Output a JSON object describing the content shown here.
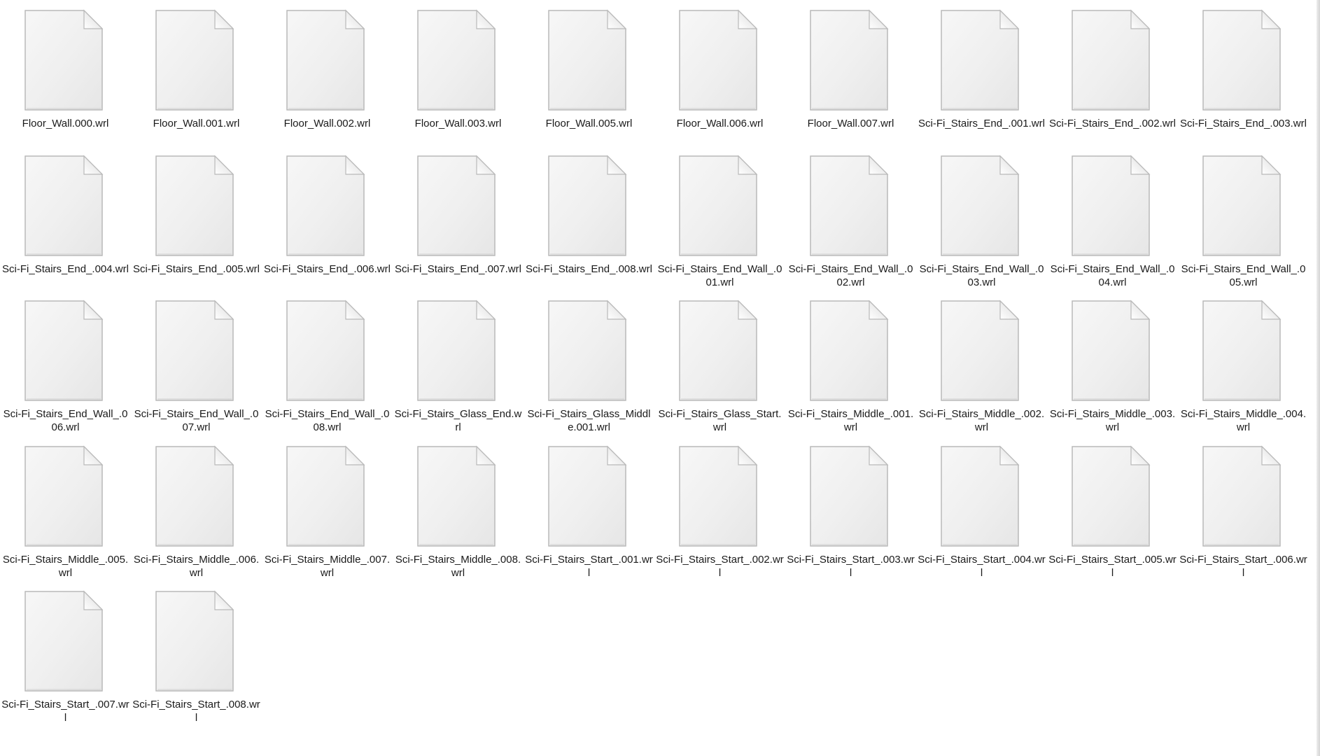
{
  "files": [
    {
      "name": "Floor_Wall.000.wrl",
      "icon": "document-icon"
    },
    {
      "name": "Floor_Wall.001.wrl",
      "icon": "document-icon"
    },
    {
      "name": "Floor_Wall.002.wrl",
      "icon": "document-icon"
    },
    {
      "name": "Floor_Wall.003.wrl",
      "icon": "document-icon"
    },
    {
      "name": "Floor_Wall.005.wrl",
      "icon": "document-icon"
    },
    {
      "name": "Floor_Wall.006.wrl",
      "icon": "document-icon"
    },
    {
      "name": "Floor_Wall.007.wrl",
      "icon": "document-icon"
    },
    {
      "name": "Sci-Fi_Stairs_End_.001.wrl",
      "icon": "document-icon"
    },
    {
      "name": "Sci-Fi_Stairs_End_.002.wrl",
      "icon": "document-icon"
    },
    {
      "name": "Sci-Fi_Stairs_End_.003.wrl",
      "icon": "document-icon"
    },
    {
      "name": "Sci-Fi_Stairs_End_.004.wrl",
      "icon": "document-icon"
    },
    {
      "name": "Sci-Fi_Stairs_End_.005.wrl",
      "icon": "document-icon"
    },
    {
      "name": "Sci-Fi_Stairs_End_.006.wrl",
      "icon": "document-icon"
    },
    {
      "name": "Sci-Fi_Stairs_End_.007.wrl",
      "icon": "document-icon"
    },
    {
      "name": "Sci-Fi_Stairs_End_.008.wrl",
      "icon": "document-icon"
    },
    {
      "name": "Sci-Fi_Stairs_End_Wall_.001.wrl",
      "icon": "document-icon"
    },
    {
      "name": "Sci-Fi_Stairs_End_Wall_.002.wrl",
      "icon": "document-icon"
    },
    {
      "name": "Sci-Fi_Stairs_End_Wall_.003.wrl",
      "icon": "document-icon"
    },
    {
      "name": "Sci-Fi_Stairs_End_Wall_.004.wrl",
      "icon": "document-icon"
    },
    {
      "name": "Sci-Fi_Stairs_End_Wall_.005.wrl",
      "icon": "document-icon"
    },
    {
      "name": "Sci-Fi_Stairs_End_Wall_.006.wrl",
      "icon": "document-icon"
    },
    {
      "name": "Sci-Fi_Stairs_End_Wall_.007.wrl",
      "icon": "document-icon"
    },
    {
      "name": "Sci-Fi_Stairs_End_Wall_.008.wrl",
      "icon": "document-icon"
    },
    {
      "name": "Sci-Fi_Stairs_Glass_End.wrl",
      "icon": "document-icon"
    },
    {
      "name": "Sci-Fi_Stairs_Glass_Middle.001.wrl",
      "icon": "document-icon"
    },
    {
      "name": "Sci-Fi_Stairs_Glass_Start.wrl",
      "icon": "document-icon"
    },
    {
      "name": "Sci-Fi_Stairs_Middle_.001.wrl",
      "icon": "document-icon"
    },
    {
      "name": "Sci-Fi_Stairs_Middle_.002.wrl",
      "icon": "document-icon"
    },
    {
      "name": "Sci-Fi_Stairs_Middle_.003.wrl",
      "icon": "document-icon"
    },
    {
      "name": "Sci-Fi_Stairs_Middle_.004.wrl",
      "icon": "document-icon"
    },
    {
      "name": "Sci-Fi_Stairs_Middle_.005.wrl",
      "icon": "document-icon"
    },
    {
      "name": "Sci-Fi_Stairs_Middle_.006.wrl",
      "icon": "document-icon"
    },
    {
      "name": "Sci-Fi_Stairs_Middle_.007.wrl",
      "icon": "document-icon"
    },
    {
      "name": "Sci-Fi_Stairs_Middle_.008.wrl",
      "icon": "document-icon"
    },
    {
      "name": "Sci-Fi_Stairs_Start_.001.wrl",
      "icon": "document-icon"
    },
    {
      "name": "Sci-Fi_Stairs_Start_.002.wrl",
      "icon": "document-icon"
    },
    {
      "name": "Sci-Fi_Stairs_Start_.003.wrl",
      "icon": "document-icon"
    },
    {
      "name": "Sci-Fi_Stairs_Start_.004.wrl",
      "icon": "document-icon"
    },
    {
      "name": "Sci-Fi_Stairs_Start_.005.wrl",
      "icon": "document-icon"
    },
    {
      "name": "Sci-Fi_Stairs_Start_.006.wrl",
      "icon": "document-icon"
    },
    {
      "name": "Sci-Fi_Stairs_Start_.007.wrl",
      "icon": "document-icon"
    },
    {
      "name": "Sci-Fi_Stairs_Start_.008.wrl",
      "icon": "document-icon"
    }
  ]
}
